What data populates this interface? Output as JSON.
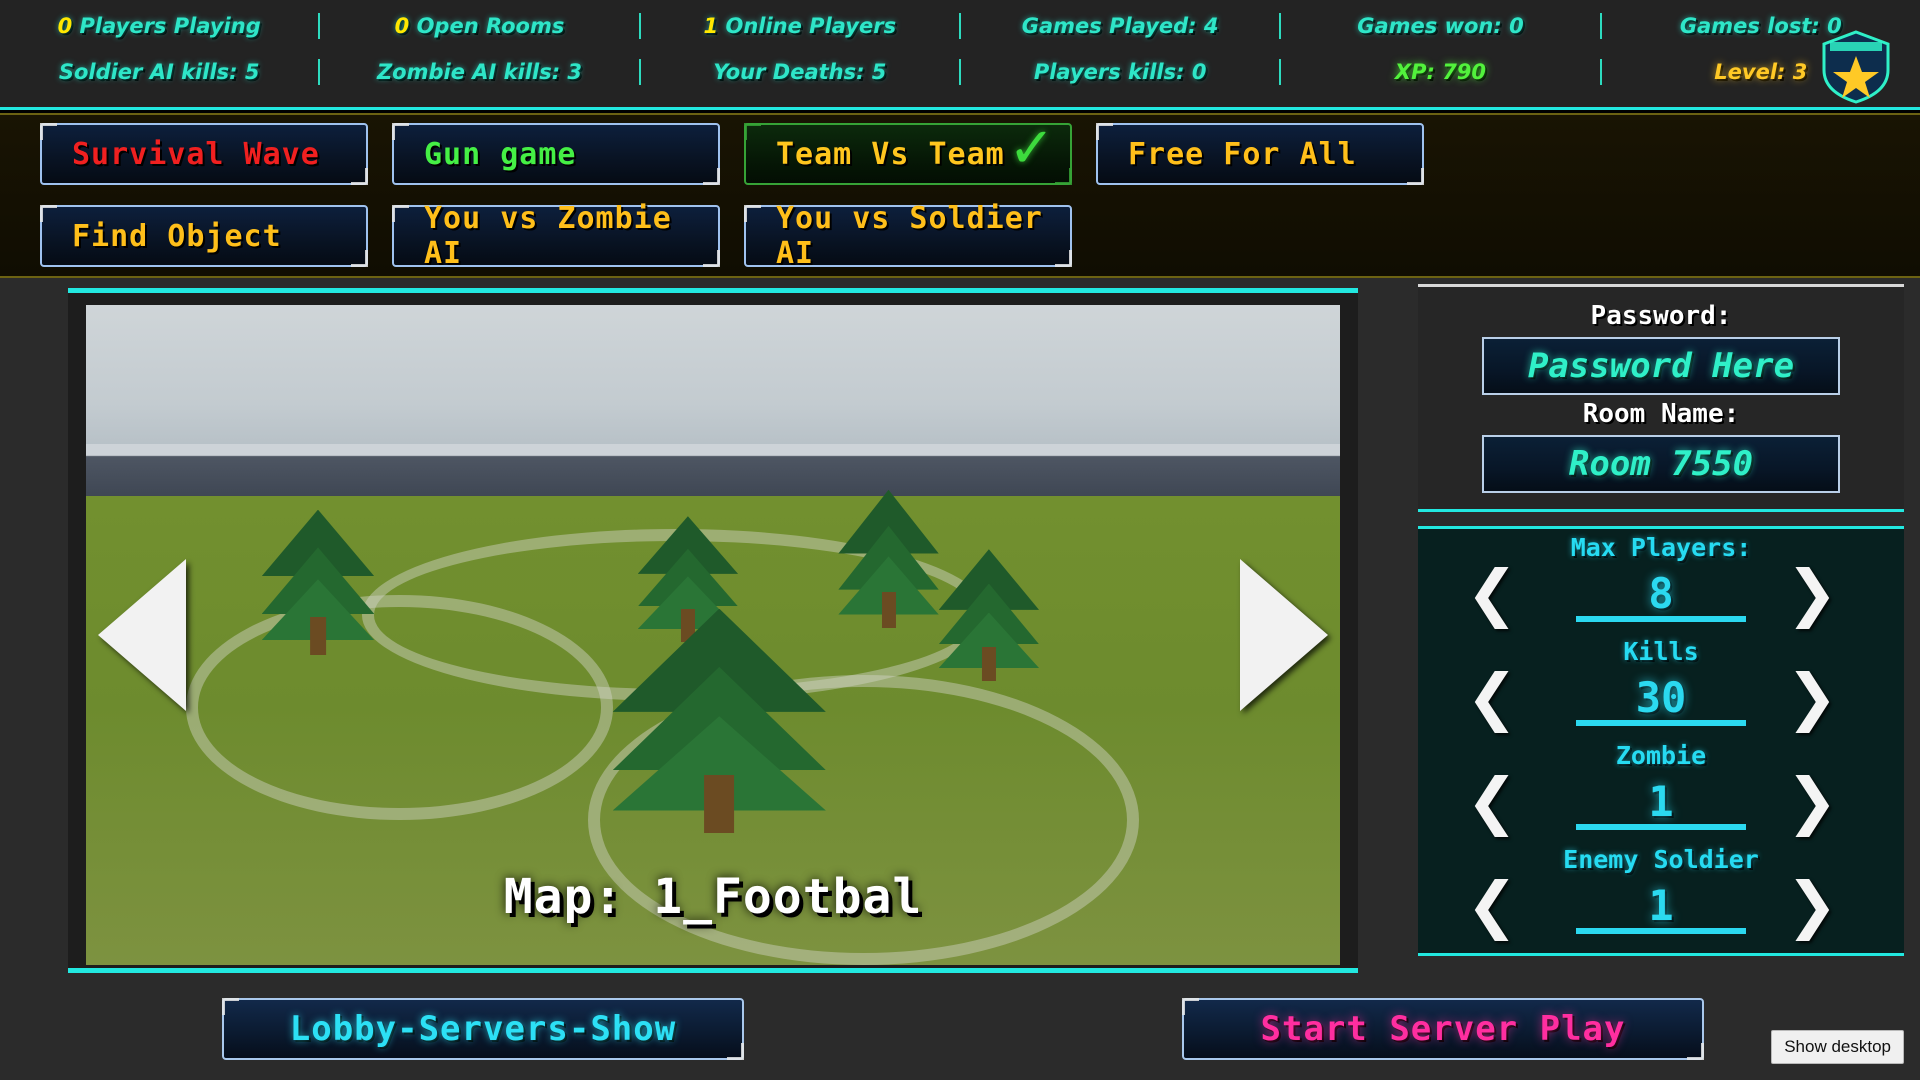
{
  "stats": {
    "row1": [
      {
        "value": "0",
        "label": " Players Playing"
      },
      {
        "value": "0",
        "label": " Open Rooms"
      },
      {
        "value": "1",
        "label": " Online Players"
      },
      {
        "value": "",
        "label": "Games Played: 4"
      },
      {
        "value": "",
        "label": "Games won: 0"
      },
      {
        "value": "",
        "label": "Games lost: 0"
      }
    ],
    "row2": [
      {
        "label": "Soldier AI kills: 5"
      },
      {
        "label": "Zombie AI kills: 3"
      },
      {
        "label": "Your Deaths: 5"
      },
      {
        "label": "Players kills: 0"
      },
      {
        "label": "XP: 790"
      },
      {
        "label": "Level: 3"
      }
    ]
  },
  "modes": {
    "row1": [
      {
        "label": "Survival Wave",
        "color": "c-red",
        "selected": false
      },
      {
        "label": "Gun game",
        "color": "c-green",
        "selected": false
      },
      {
        "label": "Team Vs Team",
        "color": "c-yellow",
        "selected": true
      },
      {
        "label": "Free For All",
        "color": "c-gold",
        "selected": false
      }
    ],
    "row2": [
      {
        "label": "Find Object",
        "color": "c-gold",
        "selected": false
      },
      {
        "label": "You vs Zombie AI",
        "color": "c-gold",
        "selected": false
      },
      {
        "label": "You vs Soldier AI",
        "color": "c-gold",
        "selected": false
      }
    ],
    "check_glyph": "✓"
  },
  "map": {
    "label": "Map: 1_Footbal",
    "prev_icon": "chevron-left",
    "next_icon": "chevron-right"
  },
  "room": {
    "password_label": "Password:",
    "password_value": "Password Here",
    "name_label": "Room Name:",
    "name_value": "Room 7550"
  },
  "settings": [
    {
      "label": "Max Players:",
      "value": "8"
    },
    {
      "label": "Kills",
      "value": "30"
    },
    {
      "label": "Zombie",
      "value": "1"
    },
    {
      "label": "Enemy Soldier",
      "value": "1"
    }
  ],
  "stepper_glyphs": {
    "left": "❮",
    "right": "❯"
  },
  "actions": {
    "lobby": "Lobby-Servers-Show",
    "start": "Start Server Play"
  },
  "taskbar": {
    "show_desktop": "Show desktop"
  },
  "colors": {
    "accent_cyan": "#22e8e0",
    "stat_text": "#2ee6c8",
    "xp": "#52f23c",
    "level": "#ffc926",
    "selected_mode": "#36a336",
    "start_btn": "#ff2ea0"
  }
}
